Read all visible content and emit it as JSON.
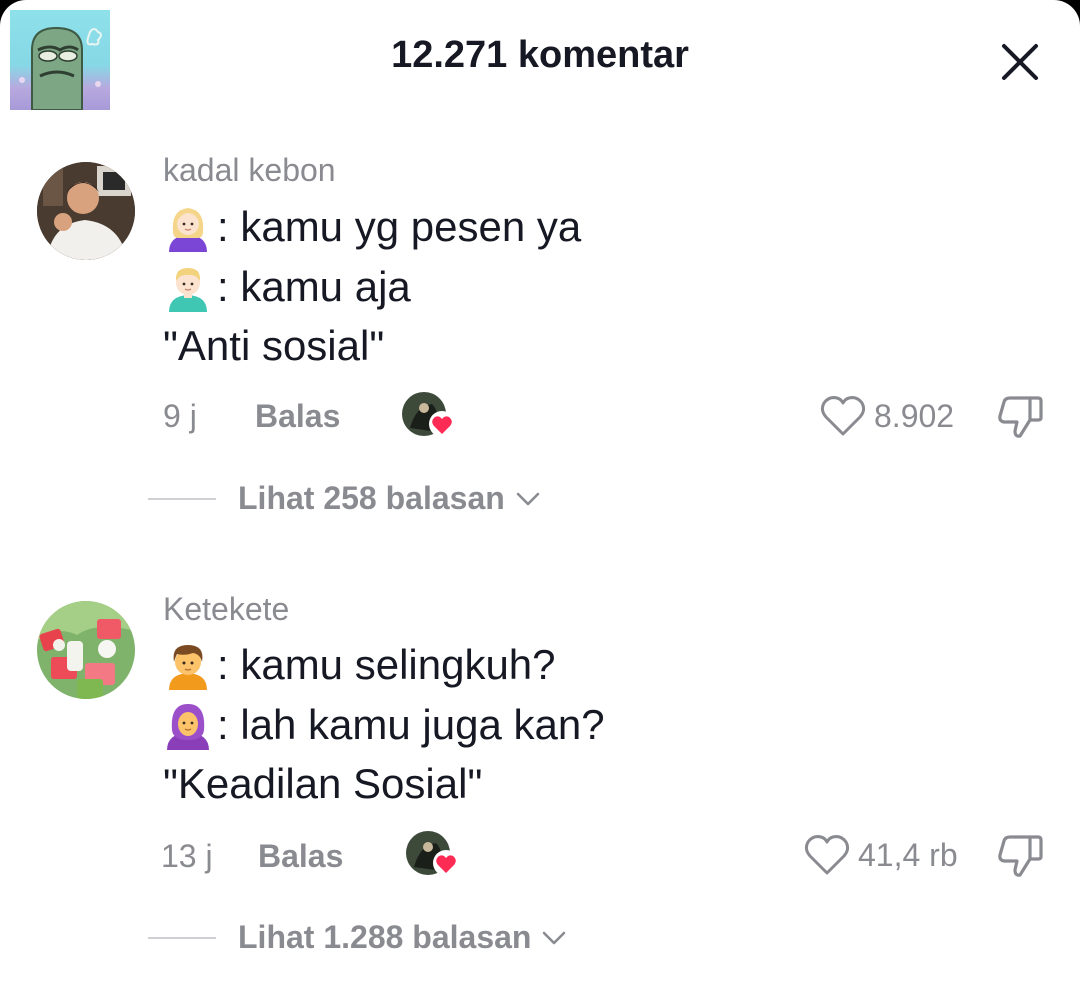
{
  "header": {
    "title": "12.271 komentar"
  },
  "comments": [
    {
      "username": "kadal kebon",
      "lines": [
        {
          "emoji": "woman-blond-icon",
          "text": ": kamu yg pesen ya"
        },
        {
          "emoji": "man-blond-icon",
          "text": ": kamu aja"
        },
        {
          "emoji": "",
          "text": "\"Anti sosial\""
        }
      ],
      "time": "9 j",
      "reply_label": "Balas",
      "likes": "8.902",
      "view_replies": "Lihat 258 balasan"
    },
    {
      "username": "Ketekete",
      "lines": [
        {
          "emoji": "person-icon",
          "text": ": kamu selingkuh?"
        },
        {
          "emoji": "woman-headscarf-icon",
          "text": ": lah kamu juga kan?"
        },
        {
          "emoji": "",
          "text": "\"Keadilan Sosial\""
        }
      ],
      "time": "13 j",
      "reply_label": "Balas",
      "likes": "41,4 rb",
      "view_replies": "Lihat 1.288 balasan"
    }
  ],
  "colors": {
    "text_primary": "#161823",
    "text_secondary": "#8a8b91",
    "heart_red": "#fe2c55"
  }
}
